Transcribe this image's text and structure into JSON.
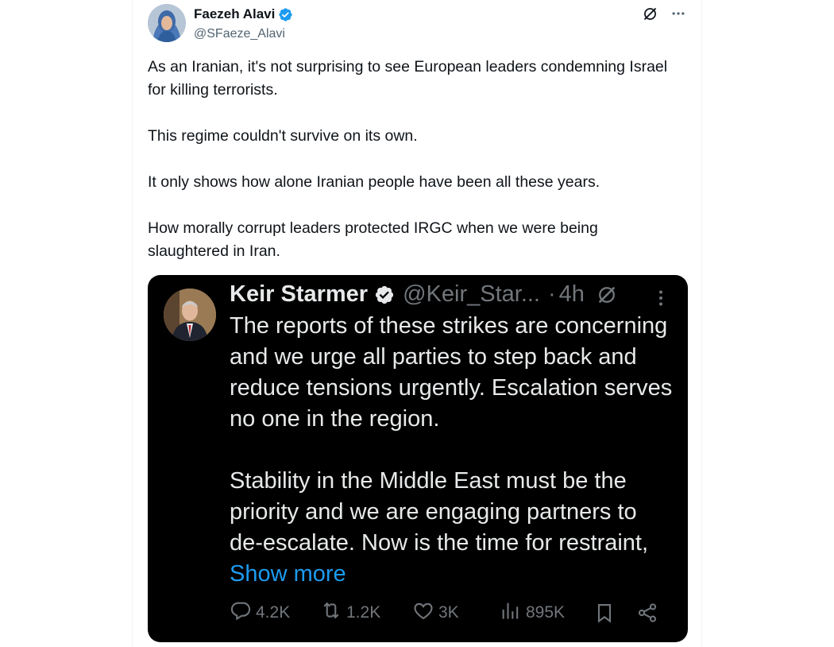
{
  "tweet": {
    "author": {
      "name": "Faezeh Alavi",
      "handle": "@SFaeze_Alavi",
      "verified": true
    },
    "paragraphs": [
      "As an Iranian, it's not surprising to see European leaders condemning Israel for killing terrorists.",
      "This regime couldn't survive on its own.",
      "It only shows how alone Iranian people have been all these years.",
      "How morally corrupt leaders protected IRGC when we were being slaughtered in Iran."
    ],
    "icons": {
      "grok": "grok-icon",
      "more": "more-options-icon"
    }
  },
  "quote": {
    "author": {
      "name": "Keir Starmer",
      "handle": "@Keir_Star...",
      "verified": true
    },
    "dot": "·",
    "time": "4h",
    "paragraph1": "The reports of these strikes are concerning and we urge all parties to step back and reduce tensions urgently. Escalation serves no one in the region.",
    "paragraph2_text": "Stability in the Middle East must be the priority and we are engaging partners to de-escalate. Now is the time for restraint,",
    "show_more": "Show more",
    "stats": {
      "replies": "4.2K",
      "reposts": "1.2K",
      "likes": "3K",
      "views": "895K"
    }
  },
  "colors": {
    "accent": "#1d9bf0",
    "dark_card": "#000000",
    "muted": "#71767b",
    "verified_badge": "#1d9bf0"
  }
}
